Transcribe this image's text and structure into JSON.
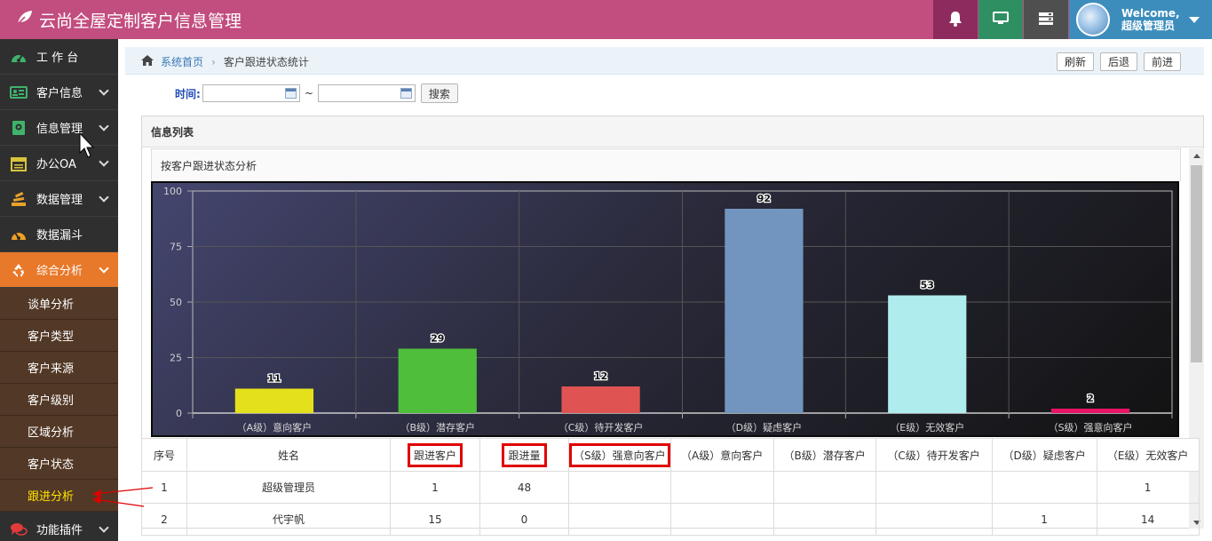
{
  "app": {
    "title": "云尚全屋定制客户信息管理",
    "welcome": "Welcome,",
    "username": "超级管理员"
  },
  "icons": {
    "logo": "leaf-icon",
    "notifications": "bell-icon",
    "screen": "monitor-icon",
    "tasks": "tasks-icon",
    "home": "home-icon"
  },
  "colors": {
    "header": "#c24d7f",
    "sidebar": "#2f2f2f",
    "active_nav": "#e8782a",
    "submenu": "#523826",
    "current_sub": "#ffe400",
    "user_box": "#3c8dbc"
  },
  "sidebar": {
    "items": [
      {
        "label": "工 作 台",
        "icon": "dashboard-icon",
        "has_children": false
      },
      {
        "label": "客户信息",
        "icon": "id-card-icon",
        "has_children": true
      },
      {
        "label": "信息管理",
        "icon": "info-box-icon",
        "has_children": true
      },
      {
        "label": "办公OA",
        "icon": "calendar-icon",
        "has_children": true
      },
      {
        "label": "数据管理",
        "icon": "stack-icon",
        "has_children": true
      },
      {
        "label": "数据漏斗",
        "icon": "gauge-icon",
        "has_children": false
      },
      {
        "label": "综合分析",
        "icon": "recycle-icon",
        "has_children": true,
        "active": true
      }
    ],
    "subitems": [
      "谈单分析",
      "客户类型",
      "客户来源",
      "客户级别",
      "区域分析",
      "客户状态",
      "跟进分析"
    ],
    "current_subitem": "跟进分析",
    "trailing_item": {
      "label": "功能插件",
      "icon": "comments-icon"
    }
  },
  "breadcrumb": {
    "home": "系统首页",
    "current": "客户跟进状态统计"
  },
  "toolbar": {
    "refresh": "刷新",
    "back": "后退",
    "forward": "前进"
  },
  "search": {
    "label": "时间:",
    "separator": "~",
    "button": "搜索",
    "start_value": "",
    "end_value": ""
  },
  "panel": {
    "title": "信息列表",
    "chart_title": "按客户跟进状态分析"
  },
  "chart_data": {
    "type": "bar",
    "title": "按客户跟进状态分析",
    "categories": [
      "（A级）意向客户",
      "（B级）潜存客户",
      "（C级）待开发客户",
      "（D级）疑虑客户",
      "（E级）无效客户",
      "（S级）强意向客户"
    ],
    "values": [
      11,
      29,
      12,
      92,
      53,
      2
    ],
    "colors": [
      "#e4e11c",
      "#4fbe3b",
      "#e05353",
      "#7295bf",
      "#aeeced",
      "#ea1466"
    ],
    "ylim": [
      0,
      100
    ],
    "yticks": [
      0,
      25,
      50,
      75,
      100
    ],
    "grid": true,
    "data_labels": true
  },
  "table": {
    "headers": [
      "序号",
      "姓名",
      "跟进客户",
      "跟进量",
      "（S级）强意向客户",
      "（A级）意向客户",
      "（B级）潜存客户",
      "（C级）待开发客户",
      "（D级）疑虑客户",
      "（E级）无效客户"
    ],
    "highlighted_headers": [
      2,
      3,
      4
    ],
    "rows": [
      [
        "1",
        "超级管理员",
        "1",
        "48",
        "",
        "",
        "",
        "",
        "",
        "1"
      ],
      [
        "2",
        "代宇帆",
        "15",
        "0",
        "",
        "",
        "",
        "",
        "1",
        "14"
      ]
    ]
  }
}
